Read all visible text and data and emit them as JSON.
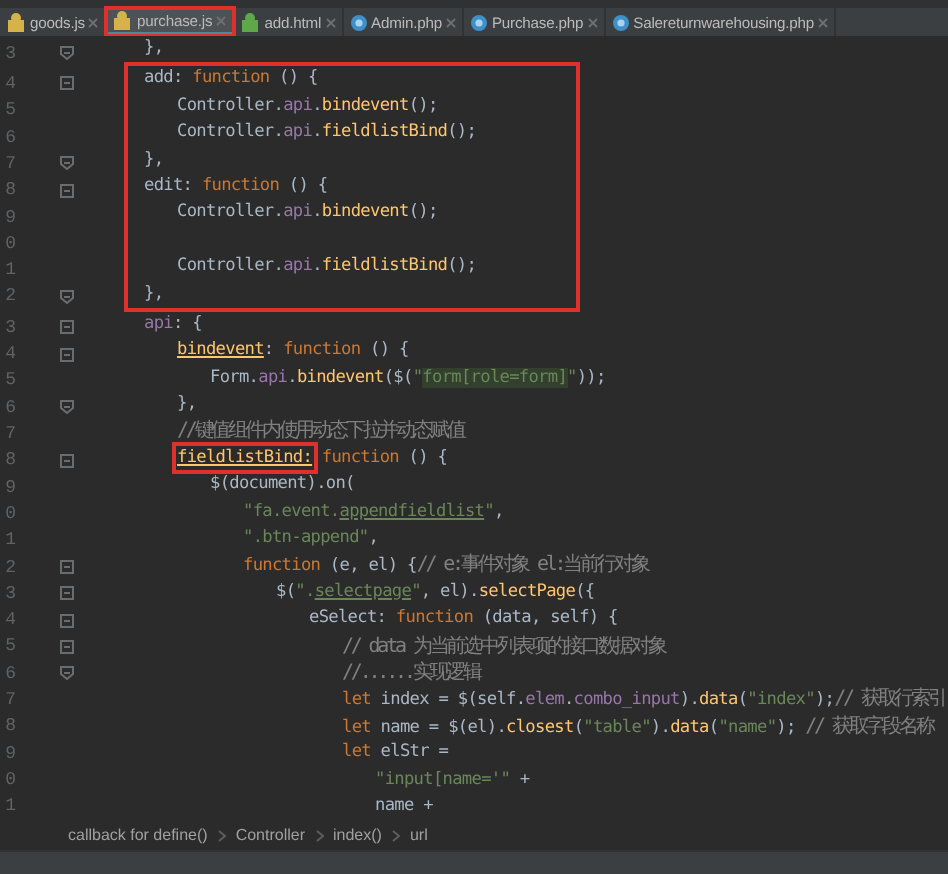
{
  "tabs": [
    {
      "label": "goods.js",
      "kind": "js",
      "selected": false,
      "boxed": false
    },
    {
      "label": "purchase.js",
      "kind": "js",
      "selected": true,
      "boxed": true
    },
    {
      "label": "add.html",
      "kind": "html",
      "selected": false,
      "boxed": false
    },
    {
      "label": "Admin.php",
      "kind": "php",
      "selected": false,
      "boxed": false
    },
    {
      "label": "Purchase.php",
      "kind": "php",
      "selected": false,
      "boxed": false
    },
    {
      "label": "Salereturnwarehousing.php",
      "kind": "php",
      "selected": false,
      "boxed": false
    }
  ],
  "editor": {
    "lines": [
      {
        "kind": "line",
        "num": "3",
        "fold_end": true,
        "tokens": [
          {
            "t": "},",
            "kind": "plain"
          }
        ]
      },
      {
        "kind": "box",
        "lines": [
          {
            "kind": "line",
            "num": "4",
            "fold_start": true,
            "tokens": [
              {
                "t": "add: ",
                "kind": "plain"
              },
              {
                "t": "function",
                "kind": "kw"
              },
              {
                "t": " () {",
                "kind": "plain"
              }
            ],
            "children": [
              {
                "kind": "line",
                "num": "5",
                "tokens": [
                  {
                    "t": "Controller.",
                    "kind": "plain"
                  },
                  {
                    "t": "api",
                    "kind": "api"
                  },
                  {
                    "t": ".",
                    "kind": "plain"
                  },
                  {
                    "t": "bindevent",
                    "kind": "fn"
                  },
                  {
                    "t": "();",
                    "kind": "plain"
                  }
                ]
              },
              {
                "kind": "line",
                "num": "6",
                "tokens": [
                  {
                    "t": "Controller.",
                    "kind": "plain"
                  },
                  {
                    "t": "api",
                    "kind": "api"
                  },
                  {
                    "t": ".",
                    "kind": "plain"
                  },
                  {
                    "t": "fieldlistBind",
                    "kind": "fn"
                  },
                  {
                    "t": "();",
                    "kind": "plain"
                  }
                ]
              }
            ]
          },
          {
            "kind": "line",
            "num": "7",
            "fold_end": true,
            "tokens": [
              {
                "t": "},",
                "kind": "plain"
              }
            ]
          },
          {
            "kind": "line",
            "num": "8",
            "fold_start": true,
            "tokens": [
              {
                "t": "edit: ",
                "kind": "plain"
              },
              {
                "t": "function",
                "kind": "kw"
              },
              {
                "t": " () {",
                "kind": "plain"
              }
            ],
            "children": [
              {
                "kind": "line",
                "num": "9",
                "tokens": [
                  {
                    "t": "Controller.",
                    "kind": "plain"
                  },
                  {
                    "t": "api",
                    "kind": "api"
                  },
                  {
                    "t": ".",
                    "kind": "plain"
                  },
                  {
                    "t": "bindevent",
                    "kind": "fn"
                  },
                  {
                    "t": "();",
                    "kind": "plain"
                  }
                ]
              },
              {
                "kind": "line",
                "num": "0"
              },
              {
                "kind": "line",
                "num": "1",
                "tokens": [
                  {
                    "t": "Controller.",
                    "kind": "plain"
                  },
                  {
                    "t": "api",
                    "kind": "api"
                  },
                  {
                    "t": ".",
                    "kind": "plain"
                  },
                  {
                    "t": "fieldlistBind",
                    "kind": "fn"
                  },
                  {
                    "t": "();",
                    "kind": "plain"
                  }
                ]
              }
            ]
          },
          {
            "kind": "line",
            "num": "2",
            "fold_end": true,
            "tokens": [
              {
                "t": "},",
                "kind": "plain"
              }
            ]
          }
        ]
      },
      {
        "kind": "line",
        "num": "3",
        "fold_start": true,
        "tokens": [
          {
            "t": "api",
            "kind": "api"
          },
          {
            "t": ": {",
            "kind": "plain"
          }
        ],
        "children": [
          {
            "kind": "line",
            "num": "4",
            "fold_start": true,
            "tokens": [
              {
                "t": "bindevent",
                "kind": "fn",
                "underline": true
              },
              {
                "t": ": ",
                "kind": "plain"
              },
              {
                "t": "function",
                "kind": "kw"
              },
              {
                "t": " () {",
                "kind": "plain"
              }
            ],
            "children": [
              {
                "kind": "line",
                "num": "5",
                "tokens": [
                  {
                    "t": "Form.",
                    "kind": "plain"
                  },
                  {
                    "t": "api",
                    "kind": "api"
                  },
                  {
                    "t": ".",
                    "kind": "plain"
                  },
                  {
                    "t": "bindevent",
                    "kind": "fn"
                  },
                  {
                    "t": "($(",
                    "kind": "plain"
                  },
                  {
                    "t": "\"",
                    "kind": "str"
                  },
                  {
                    "t": "form[role=form]",
                    "kind": "str-hl"
                  },
                  {
                    "t": "\"",
                    "kind": "str"
                  },
                  {
                    "t": "));",
                    "kind": "plain"
                  }
                ]
              }
            ]
          },
          {
            "kind": "line",
            "num": "6",
            "fold_end": true,
            "tokens": [
              {
                "t": "},",
                "kind": "plain"
              }
            ]
          },
          {
            "kind": "line",
            "num": "7",
            "tokens": [
              {
                "t": "//键值组件内使用动态下拉并动态赋值",
                "kind": "cmt"
              }
            ]
          },
          {
            "kind": "line",
            "num": "8",
            "fold_start": true,
            "tokens": [
              {
                "t": "fieldlistBind:",
                "kind": "fn",
                "underline": true,
                "boxed": true
              },
              {
                "t": " function",
                "kind": "kw"
              },
              {
                "t": " () {",
                "kind": "plain"
              }
            ],
            "children": [
              {
                "kind": "line",
                "num": "9",
                "tokens": [
                  {
                    "t": "$(document).on(",
                    "kind": "plain"
                  }
                ],
                "children": [
                  {
                    "kind": "line",
                    "num": "0",
                    "tokens": [
                      {
                        "t": "\"fa.event.",
                        "kind": "str"
                      },
                      {
                        "t": "appendfieldlist",
                        "kind": "str",
                        "underline": true
                      },
                      {
                        "t": "\"",
                        "kind": "str"
                      },
                      {
                        "t": ",",
                        "kind": "plain"
                      }
                    ]
                  },
                  {
                    "kind": "line",
                    "num": "1",
                    "tokens": [
                      {
                        "t": "\".btn-append\"",
                        "kind": "str"
                      },
                      {
                        "t": ",",
                        "kind": "plain"
                      }
                    ]
                  },
                  {
                    "kind": "line",
                    "num": "2",
                    "fold_start": true,
                    "tokens": [
                      {
                        "t": "function",
                        "kind": "kw"
                      },
                      {
                        "t": " (e, el) {",
                        "kind": "plain"
                      },
                      {
                        "t": "// e:事件对象 el:当前行对象",
                        "kind": "cmt"
                      }
                    ],
                    "children": [
                      {
                        "kind": "line",
                        "num": "3",
                        "fold_start": true,
                        "tokens": [
                          {
                            "t": "$(",
                            "kind": "plain"
                          },
                          {
                            "t": "\".",
                            "kind": "str"
                          },
                          {
                            "t": "selectpage",
                            "kind": "str",
                            "underline": true
                          },
                          {
                            "t": "\"",
                            "kind": "str"
                          },
                          {
                            "t": ", el).",
                            "kind": "plain"
                          },
                          {
                            "t": "selectPage",
                            "kind": "fn"
                          },
                          {
                            "t": "({",
                            "kind": "plain"
                          }
                        ],
                        "children": [
                          {
                            "kind": "line",
                            "num": "4",
                            "fold_start": true,
                            "tokens": [
                              {
                                "t": "eSelect: ",
                                "kind": "plain"
                              },
                              {
                                "t": "function",
                                "kind": "kw"
                              },
                              {
                                "t": " (data, self) {",
                                "kind": "plain"
                              }
                            ],
                            "children": [
                              {
                                "kind": "line",
                                "num": "5",
                                "fold_start": true,
                                "tokens": [
                                  {
                                    "t": "// data 为当前选中列表项的接口数据对象",
                                    "kind": "cmt"
                                  }
                                ]
                              },
                              {
                                "kind": "line",
                                "num": "6",
                                "fold_end": true,
                                "tokens": [
                                  {
                                    "t": "//......实现逻辑",
                                    "kind": "cmt"
                                  }
                                ]
                              },
                              {
                                "kind": "line",
                                "num": "7",
                                "tokens": [
                                  {
                                    "t": "let",
                                    "kind": "kw"
                                  },
                                  {
                                    "t": " index = $(self.",
                                    "kind": "plain"
                                  },
                                  {
                                    "t": "elem",
                                    "kind": "api"
                                  },
                                  {
                                    "t": ".",
                                    "kind": "plain"
                                  },
                                  {
                                    "t": "combo_input",
                                    "kind": "api"
                                  },
                                  {
                                    "t": ").",
                                    "kind": "plain"
                                  },
                                  {
                                    "t": "data",
                                    "kind": "fn"
                                  },
                                  {
                                    "t": "(",
                                    "kind": "plain"
                                  },
                                  {
                                    "t": "\"index\"",
                                    "kind": "str"
                                  },
                                  {
                                    "t": ");",
                                    "kind": "plain"
                                  },
                                  {
                                    "t": "// 获取行索引",
                                    "kind": "cmt"
                                  }
                                ]
                              },
                              {
                                "kind": "line",
                                "num": "8",
                                "tokens": [
                                  {
                                    "t": "let",
                                    "kind": "kw"
                                  },
                                  {
                                    "t": " name = $(el).",
                                    "kind": "plain"
                                  },
                                  {
                                    "t": "closest",
                                    "kind": "fn"
                                  },
                                  {
                                    "t": "(",
                                    "kind": "plain"
                                  },
                                  {
                                    "t": "\"table\"",
                                    "kind": "str"
                                  },
                                  {
                                    "t": ").",
                                    "kind": "plain"
                                  },
                                  {
                                    "t": "data",
                                    "kind": "fn"
                                  },
                                  {
                                    "t": "(",
                                    "kind": "plain"
                                  },
                                  {
                                    "t": "\"name\"",
                                    "kind": "str"
                                  },
                                  {
                                    "t": "); ",
                                    "kind": "plain"
                                  },
                                  {
                                    "t": "// 获取字段名称",
                                    "kind": "cmt"
                                  }
                                ]
                              },
                              {
                                "kind": "line",
                                "num": "9",
                                "tokens": [
                                  {
                                    "t": "let",
                                    "kind": "kw"
                                  },
                                  {
                                    "t": " elStr =",
                                    "kind": "plain"
                                  }
                                ],
                                "children": [
                                  {
                                    "kind": "line",
                                    "num": "0",
                                    "tokens": [
                                      {
                                        "t": "\"input[name='\"",
                                        "kind": "str"
                                      },
                                      {
                                        "t": " +",
                                        "kind": "plain"
                                      }
                                    ]
                                  },
                                  {
                                    "kind": "line",
                                    "num": "1",
                                    "tokens": [
                                      {
                                        "t": "name +",
                                        "kind": "plain"
                                      }
                                    ]
                                  }
                                ]
                              }
                            ]
                          }
                        ]
                      }
                    ]
                  }
                ]
              }
            ]
          }
        ]
      }
    ]
  },
  "breadcrumb": [
    "callback for define()",
    "Controller",
    "index()",
    "url"
  ]
}
